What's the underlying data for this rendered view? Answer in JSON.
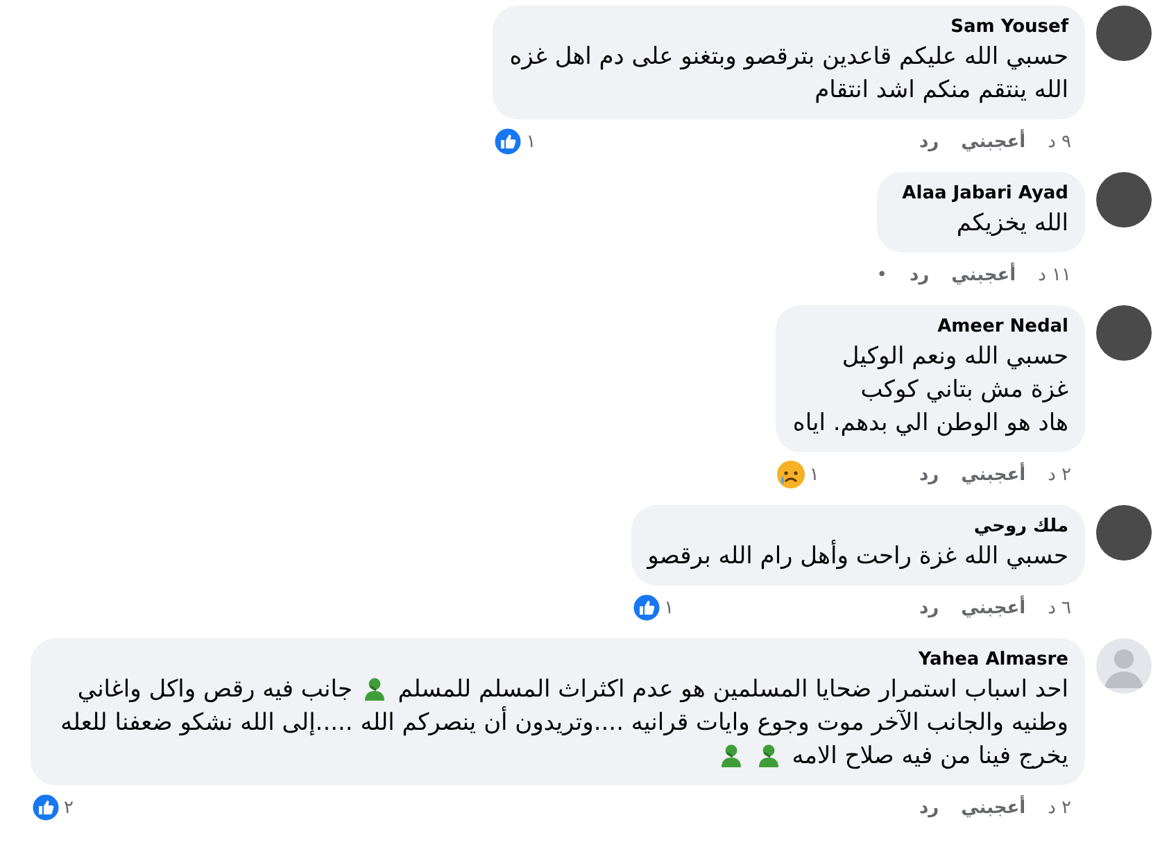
{
  "comments": [
    {
      "author": "Sam Yousef",
      "avatar": {
        "kind": "photo"
      },
      "body": [
        {
          "kind": "text",
          "text": "حسبي الله عليكم قاعدين بترقصو وبتغنو على دم اهل غزه"
        },
        {
          "kind": "break"
        },
        {
          "kind": "text",
          "text": "الله ينتقم منكم اشد انتقام"
        }
      ],
      "time": "٩ د",
      "like": "أعجبني",
      "reply": "رد",
      "reaction": {
        "kind": "like",
        "count": "١"
      }
    },
    {
      "author": "Alaa Jabari Ayad",
      "avatar": {
        "kind": "photo"
      },
      "body": [
        {
          "kind": "text",
          "text": "الله يخزيكم"
        }
      ],
      "time": "١١ د",
      "like": "أعجبني",
      "reply": "رد",
      "extra": "•"
    },
    {
      "author": "Ameer Nedal",
      "avatar": {
        "kind": "photo"
      },
      "body": [
        {
          "kind": "text",
          "text": "حسبي الله ونعم الوكيل"
        },
        {
          "kind": "break"
        },
        {
          "kind": "text",
          "text": "غزة مش بتاني كوكب"
        },
        {
          "kind": "break"
        },
        {
          "kind": "text",
          "text": "هاد هو الوطن الي بدهم. اياه"
        }
      ],
      "time": "٢ د",
      "like": "أعجبني",
      "reply": "رد",
      "reaction": {
        "kind": "sad",
        "count": "١"
      }
    },
    {
      "author": "ملك روحي",
      "avatar": {
        "kind": "photo"
      },
      "body": [
        {
          "kind": "text",
          "text": "حسبي الله غزة راحت وأهل رام الله برقصو"
        }
      ],
      "time": "٦ د",
      "like": "أعجبني",
      "reply": "رد",
      "reaction": {
        "kind": "like",
        "count": "١"
      }
    },
    {
      "author": "Yahea Almasre",
      "avatar": {
        "kind": "default"
      },
      "body": [
        {
          "kind": "text",
          "text": "احد اسباب استمرار ضحايا المسلمين هو عدم اكثراث المسلم للمسلم"
        },
        {
          "kind": "emoji"
        },
        {
          "kind": "text",
          "text": "جانب فيه رقص واكل واغاني وطنيه والجانب الآخر موت وجوع وايات قرانيه ....وتريدون أن ينصركم الله .....إلى الله نشكو ضعفنا للعله يخرج فينا من فيه صلاح الامه"
        },
        {
          "kind": "emoji"
        },
        {
          "kind": "emoji"
        }
      ],
      "time": "٢ د",
      "like": "أعجبني",
      "reply": "رد",
      "reaction": {
        "kind": "like",
        "count": "٢"
      }
    }
  ]
}
